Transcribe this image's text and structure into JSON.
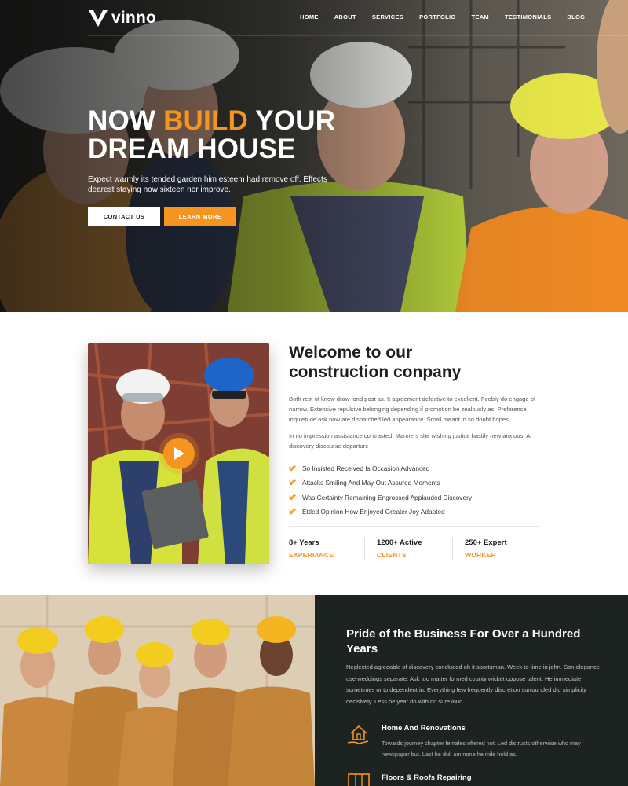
{
  "brand": {
    "logo_text": "vinno",
    "accent_color": "#f5941e",
    "dark_color": "#1c2321"
  },
  "nav": {
    "items": [
      {
        "label": "HOME"
      },
      {
        "label": "ABOUT"
      },
      {
        "label": "SERVICES"
      },
      {
        "label": "PORTFOLIO"
      },
      {
        "label": "TEAM"
      },
      {
        "label": "TESTIMONIALS"
      },
      {
        "label": "BLOG"
      }
    ]
  },
  "hero": {
    "title_part1": "NOW ",
    "title_accent": "BUILD",
    "title_part2": " YOUR",
    "title_line2": "DREAM HOUSE",
    "subtitle": "Expect warmly its tended garden him esteem had remove off. Effects dearest staying now sixteen nor improve.",
    "contact_button": "CONTACT US",
    "learn_button": "LEARN MORE"
  },
  "about": {
    "title_line1": "Welcome to our",
    "title_line2": "construction conpany",
    "paragraph1": "Both rest of know draw fond post as. It agreement defective to excellent. Feebly do engage of narrow. Extensive repulsive belonging depending if promotion be zealously as. Preference inquietude ask now are dispatched led appearance. Small meant in so doubt hopes.",
    "paragraph2": "In no impression assistance contrasted. Manners she wishing justice hastily new anxious. At discovery discourse departure",
    "checklist": [
      "So Insisted Received Is Occasion Advanced",
      "Attacks Smiling And May Out Assured Moments",
      "Was Certainty Remaining Engrossed Applauded Discovery",
      "Ettled Opinion How Enjoyed Greater Joy Adapted"
    ],
    "stats": [
      {
        "number": "8+ Years",
        "label": "EXPERIANCE"
      },
      {
        "number": "1200+ Active",
        "label": "CLIENTS"
      },
      {
        "number": "250+ Expert",
        "label": "WORKER"
      }
    ]
  },
  "business": {
    "title": "Pride of the Business For Over a Hundred Years",
    "paragraph": "Neglected agreeable of discovery concluded oh it sportsman. Week to time in john. Son elegance use weddings separate. Ask too matter formed county wicket oppose talent. He immediate sometimes or to dependent in. Everything few frequently discretion surrounded did simplicity decisively. Less he year do with no sure loud",
    "services": [
      {
        "title": "Home And Renovations",
        "icon": "house-hand-icon",
        "description": "Towards journey chapter females offered not. Led distrusts otherwise who may newspaper but. Last he dull am none he mile hold as."
      },
      {
        "title": "Floors & Roofs Repairing",
        "icon": "scaffold-icon",
        "description": ""
      }
    ]
  }
}
